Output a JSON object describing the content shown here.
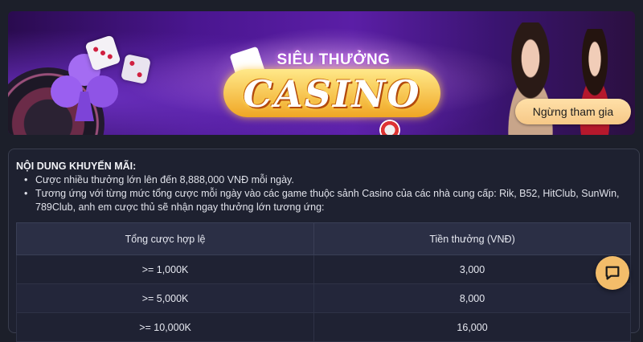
{
  "banner": {
    "logo_top": "SIÊU THƯỞNG",
    "logo_main": "CASINO",
    "stop_button": "Ngừng tham gia"
  },
  "promo": {
    "heading": "NỘI DUNG KHUYẾN MÃI:",
    "bullets": [
      "Cược nhiều thưởng lớn lên đến 8,888,000 VNĐ mỗi ngày.",
      "Tương ứng với từng mức tổng cược mỗi ngày vào các game thuộc sảnh Casino của các nhà cung cấp: Rik, B52, HitClub, SunWin, 789Club, anh em cược thủ sẽ nhận ngay thưởng lớn tương ứng:"
    ],
    "table": {
      "headers": [
        "Tổng cược hợp lệ",
        "Tiền thưởng (VNĐ)"
      ],
      "rows": [
        [
          ">= 1,000K",
          "3,000"
        ],
        [
          ">= 5,000K",
          "8,000"
        ],
        [
          ">= 10,000K",
          "16,000"
        ]
      ]
    }
  },
  "icons": {
    "chat": "chat-bubble-icon"
  },
  "colors": {
    "background": "#1c1f2a",
    "button_gold": "#f6c887",
    "chat_button": "#f3bd6a"
  }
}
